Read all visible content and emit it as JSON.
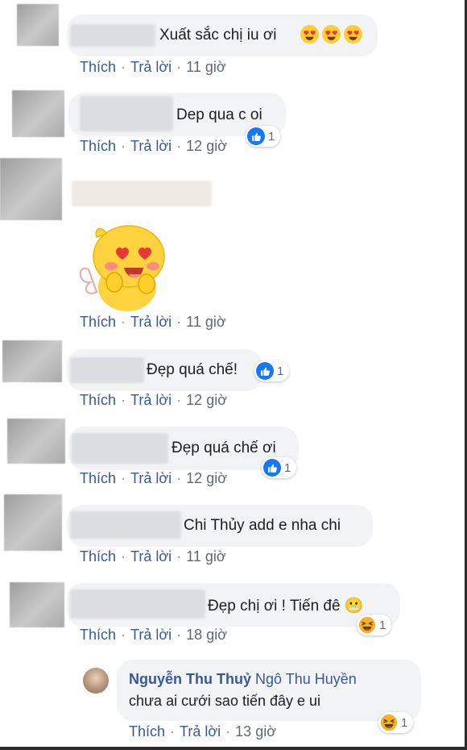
{
  "labels": {
    "like": "Thích",
    "reply": "Trả lời",
    "dot": "·"
  },
  "comments": [
    {
      "text": "Xuất sắc chị iu ơi",
      "emoji": "heart-eyes-emoji x3",
      "time": "11 giờ"
    },
    {
      "text": "Dep qua c oi",
      "time": "12 giờ",
      "reaction": {
        "type": "like",
        "count": "1"
      }
    },
    {
      "text": "",
      "sticker": "yellow-bird-heart-eyes-sticker",
      "time": "11 giờ"
    },
    {
      "text": "Đẹp quá chế!",
      "time": "12 giờ",
      "reaction": {
        "type": "like",
        "count": "1"
      }
    },
    {
      "text": "Đẹp quá chế ơi",
      "time": "12 giờ",
      "reaction": {
        "type": "like",
        "count": "1"
      }
    },
    {
      "text": "Chi Thủy add e nha chi",
      "time": "11 giờ"
    },
    {
      "text": "Đẹp chị ơi ! Tiến đê 😬",
      "time": "18 giờ",
      "reaction": {
        "type": "haha",
        "count": "1"
      }
    }
  ],
  "reply": {
    "author": "Nguyễn Thu Thuỷ",
    "mention": "Ngô Thu Huyền",
    "text": "chưa ai cưới sao tiến đây e ui",
    "time": "13 giờ",
    "reaction": {
      "type": "haha",
      "count": "1"
    }
  },
  "colors": {
    "link": "#385898",
    "bubble": "#f2f3f5",
    "like": "#1877f2",
    "haha": "#f7b125"
  }
}
